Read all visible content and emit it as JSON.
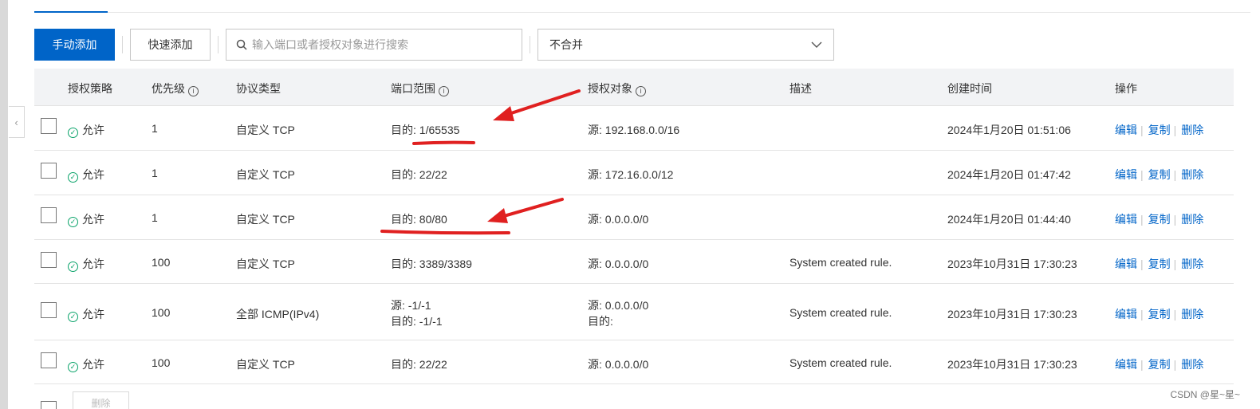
{
  "toolbar": {
    "manual_add": "手动添加",
    "quick_add": "快速添加",
    "search_placeholder": "输入端口或者授权对象进行搜索",
    "merge_select": "不合并"
  },
  "columns": {
    "policy": "授权策略",
    "priority": "优先级",
    "protocol": "协议类型",
    "port_range": "端口范围",
    "auth_object": "授权对象",
    "description": "描述",
    "created": "创建时间",
    "actions": "操作"
  },
  "info_glyph": "i",
  "check_glyph": "✓",
  "rows": [
    {
      "policy": "允许",
      "priority": "1",
      "protocol": "自定义 TCP",
      "port": [
        "目的: 1/65535"
      ],
      "auth": [
        "源: 192.168.0.0/16"
      ],
      "desc": "",
      "created": "2024年1月20日 01:51:06"
    },
    {
      "policy": "允许",
      "priority": "1",
      "protocol": "自定义 TCP",
      "port": [
        "目的: 22/22"
      ],
      "auth": [
        "源: 172.16.0.0/12"
      ],
      "desc": "",
      "created": "2024年1月20日 01:47:42"
    },
    {
      "policy": "允许",
      "priority": "1",
      "protocol": "自定义 TCP",
      "port": [
        "目的: 80/80"
      ],
      "auth": [
        "源: 0.0.0.0/0"
      ],
      "desc": "",
      "created": "2024年1月20日 01:44:40"
    },
    {
      "policy": "允许",
      "priority": "100",
      "protocol": "自定义 TCP",
      "port": [
        "目的: 3389/3389"
      ],
      "auth": [
        "源: 0.0.0.0/0"
      ],
      "desc": "System created rule.",
      "created": "2023年10月31日 17:30:23"
    },
    {
      "policy": "允许",
      "priority": "100",
      "protocol": "全部 ICMP(IPv4)",
      "port": [
        "源: -1/-1",
        "目的: -1/-1"
      ],
      "auth": [
        "源: 0.0.0.0/0",
        "目的:"
      ],
      "desc": "System created rule.",
      "created": "2023年10月31日 17:30:23"
    },
    {
      "policy": "允许",
      "priority": "100",
      "protocol": "自定义 TCP",
      "port": [
        "目的: 22/22"
      ],
      "auth": [
        "源: 0.0.0.0/0"
      ],
      "desc": "System created rule.",
      "created": "2023年10月31日 17:30:23"
    }
  ],
  "actions": {
    "edit": "编辑",
    "copy": "复制",
    "delete": "删除"
  },
  "footer": {
    "delete_button": "删除"
  },
  "watermark": "CSDN @星~星~",
  "colors": {
    "primary": "#0064c8",
    "allow": "#0aa36a",
    "annotation": "#e02020"
  }
}
